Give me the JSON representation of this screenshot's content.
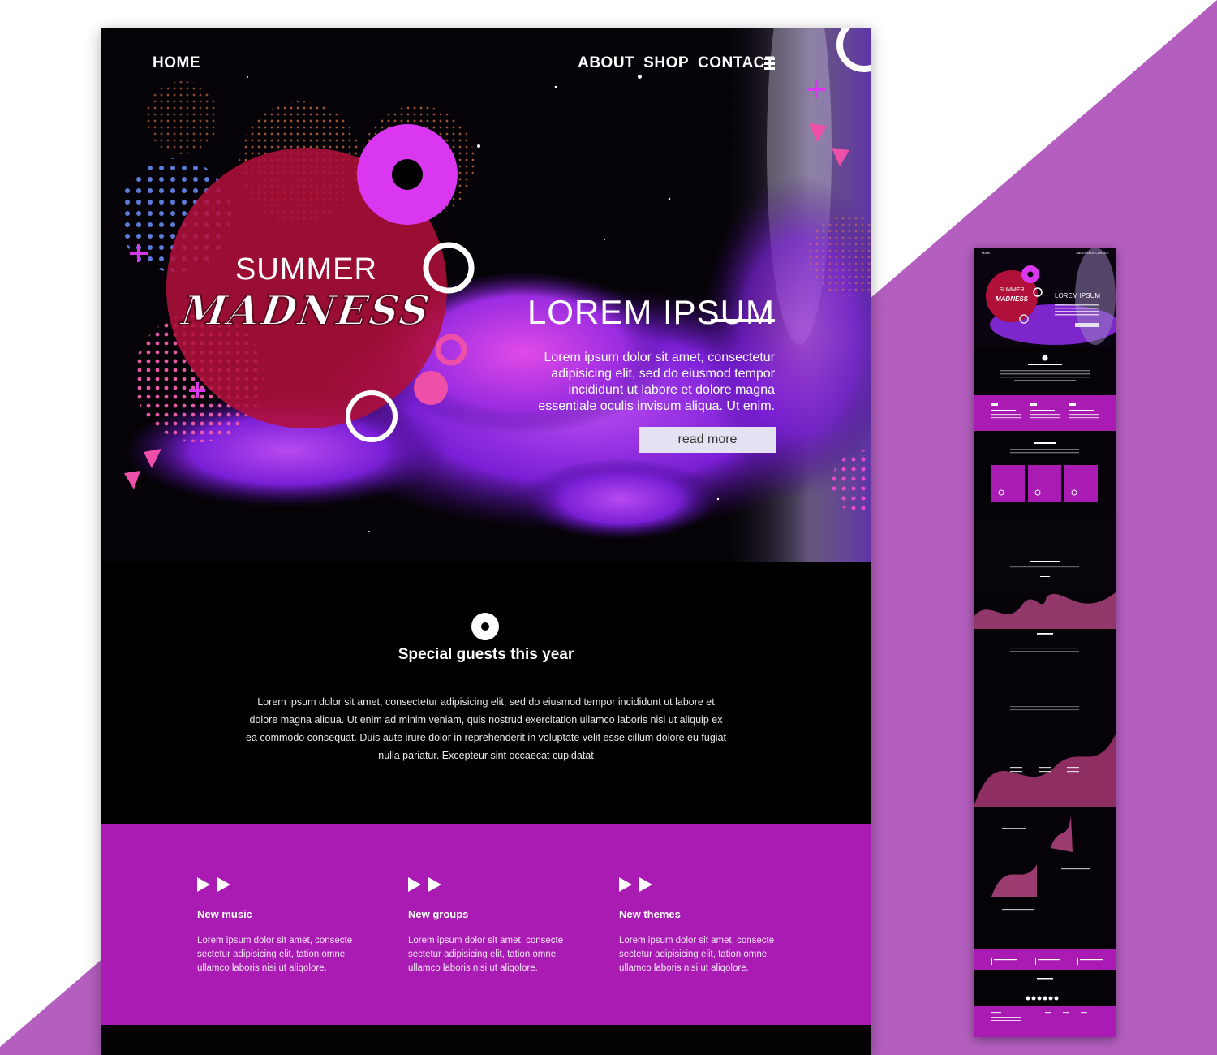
{
  "colors": {
    "accent_purple": "#a91bb3",
    "background_diagonal": "#b45fbf",
    "hero_red": "#b0103a",
    "magenta": "#d937f0",
    "button_bg": "#e4e1f3"
  },
  "nav": {
    "home": "HOME",
    "about": "ABOUT",
    "shop": "SHOP",
    "contact": "CONTACT",
    "menu_icon": "hamburger-menu-icon"
  },
  "hero": {
    "badge_line1": "SUMMER",
    "badge_line2": "MADNESS",
    "title": "LOREM IPSUM",
    "text": "Lorem ipsum dolor sit amet, consectetur adipisicing elit, sed do eiusmod tempor incididunt ut labore et dolore magna essentiale oculis invisum aliqua. Ut enim.",
    "button": "read more"
  },
  "guests": {
    "icon": "disc-icon",
    "title": "Special guests this year",
    "text": "Lorem ipsum dolor sit amet, consectetur adipisicing elit, sed do eiusmod tempor incididunt ut labore et dolore magna aliqua. Ut enim ad minim veniam, quis nostrud exercitation ullamco laboris nisi ut aliquip ex ea commodo consequat. Duis aute irure dolor in reprehenderit in voluptate velit esse cillum dolore eu fugiat nulla pariatur. Excepteur sint occaecat cupidatat"
  },
  "features": [
    {
      "icon": "fast-forward-icon",
      "title": "New music",
      "text": "Lorem ipsum dolor sit amet, consecte sectetur adipisicing elit, tation omne ullamco laboris nisi ut aliqolore."
    },
    {
      "icon": "fast-forward-icon",
      "title": "New groups",
      "text": "Lorem ipsum dolor sit amet, consecte sectetur adipisicing elit, tation omne ullamco laboris nisi ut aliqolore."
    },
    {
      "icon": "fast-forward-icon",
      "title": "New themes",
      "text": "Lorem ipsum dolor sit amet, consecte sectetur adipisicing elit, tation omne ullamco laboris nisi ut aliqolore."
    }
  ],
  "mobile_preview": {
    "home": "HOME",
    "nav": "ABOUT SHOP CONTACT",
    "badge_line1": "SUMMER",
    "badge_line2": "MADNESS",
    "title": "LOREM IPSUM"
  }
}
